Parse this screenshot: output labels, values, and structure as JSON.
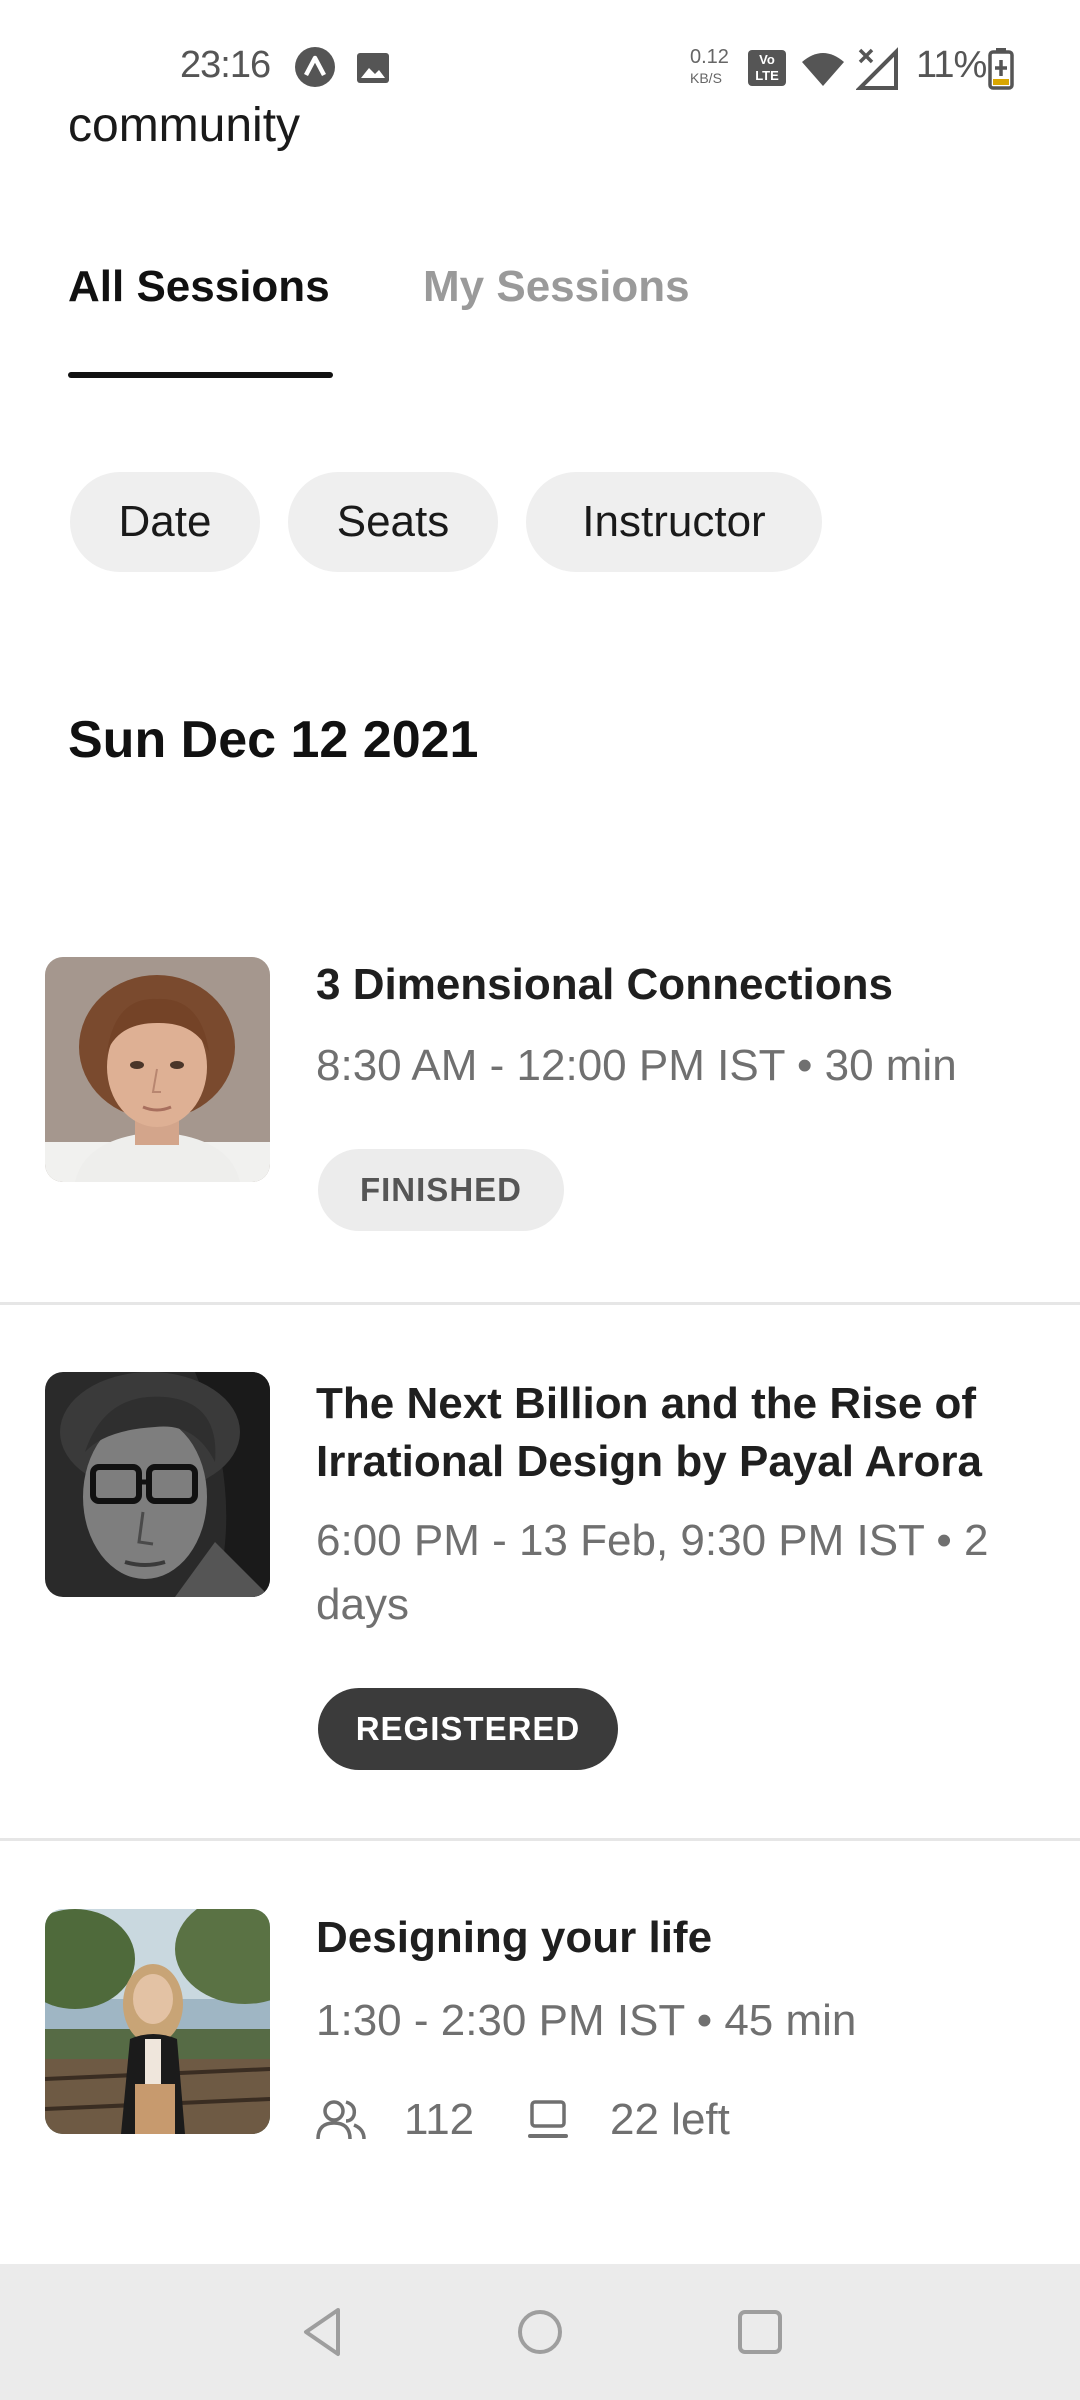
{
  "status_bar": {
    "time": "23:16",
    "net_speed_value": "0.12",
    "net_speed_unit": "KB/S",
    "volte_label": "Vo LTE",
    "battery": "11%",
    "icons": [
      "app-a-icon",
      "image-icon",
      "wifi-icon",
      "signal-icon",
      "battery-charging-icon"
    ]
  },
  "header": {
    "partial_title": "community"
  },
  "tabs": [
    {
      "label": "All Sessions",
      "active": true
    },
    {
      "label": "My Sessions",
      "active": false
    }
  ],
  "filters": [
    {
      "label": "Date"
    },
    {
      "label": "Seats"
    },
    {
      "label": "Instructor"
    }
  ],
  "date_heading": "Sun Dec 12 2021",
  "sessions": [
    {
      "title": "3 Dimensional Connections",
      "time": "8:30 AM - 12:00 PM IST • 30 min",
      "badge": "FINISHED"
    },
    {
      "title": "The Next Billion and the Rise of Irrational Design by Payal Arora",
      "time": "6:00 PM - 13 Feb, 9:30 PM IST • 2 days",
      "badge": "REGISTERED"
    },
    {
      "title": "Designing your life",
      "time": "1:30 - 2:30 PM IST • 45 min",
      "attendees": "112",
      "seats_left": "22 left"
    }
  ],
  "colors": {
    "accent_dark": "#3b3b3b",
    "chip_bg": "#efefef",
    "muted_text": "#707070",
    "inactive_tab": "#9a9a9a"
  },
  "nav": {
    "icons": [
      "back-icon",
      "home-icon",
      "recents-icon"
    ]
  }
}
